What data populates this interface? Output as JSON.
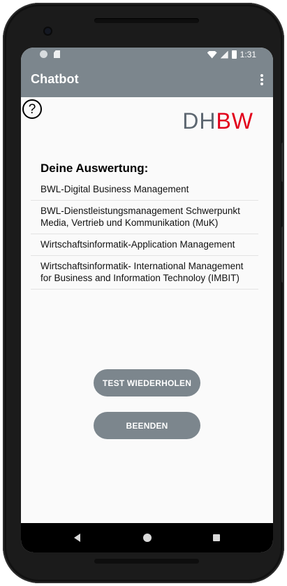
{
  "status_bar": {
    "time": "1:31",
    "icons": [
      "notification-dot-icon",
      "sd-card-icon",
      "wifi-icon",
      "signal-icon",
      "battery-icon"
    ]
  },
  "app_bar": {
    "title": "Chatbot",
    "overflow_icon": "more-vert-icon",
    "background": "#7c868d"
  },
  "help": {
    "icon": "question-mark-circle-icon",
    "glyph": "?"
  },
  "logo": {
    "part1": "DH",
    "part2": "BW",
    "part1_color": "#5c6670",
    "part2_color": "#e2001a"
  },
  "results": {
    "heading": "Deine Auswertung:",
    "items": [
      "BWL-Digital Business Management",
      "BWL-Dienstleistungsmanagement Schwerpunkt Media, Vertrieb und Kommunikation (MuK)",
      "Wirtschaftsinformatik-Application Management",
      "Wirtschaftsinformatik- International Management for Business and Information Technoloy (IMBIT)"
    ]
  },
  "buttons": {
    "retry": "TEST WIEDERHOLEN",
    "quit": "BEENDEN",
    "color": "#7c868d"
  },
  "nav_bar": {
    "icons": [
      "back-icon",
      "home-icon",
      "recents-icon"
    ]
  }
}
